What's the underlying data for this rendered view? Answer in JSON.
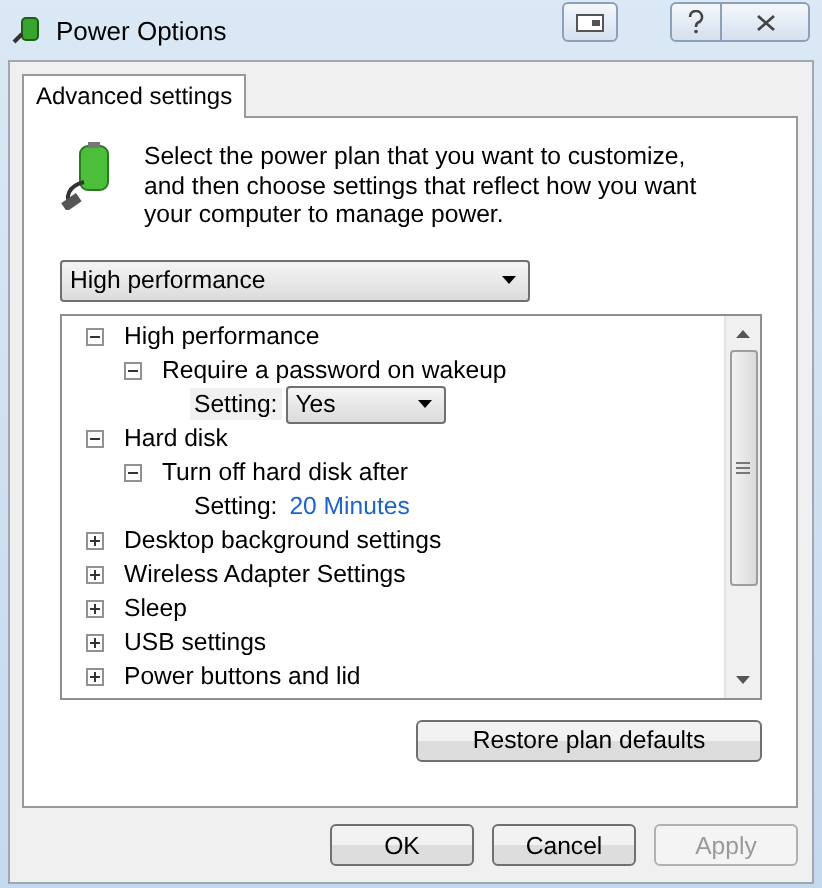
{
  "window": {
    "title": "Power Options"
  },
  "tabs": [
    {
      "label": "Advanced settings",
      "selected": true
    }
  ],
  "intro": "Select the power plan that you want to customize, and then choose settings that reflect how you want your computer to manage power.",
  "plan_dropdown": {
    "value": "High performance"
  },
  "tree": {
    "items": [
      {
        "kind": "group",
        "label": "High performance",
        "expanded": true,
        "children": [
          {
            "kind": "group",
            "label": "Require a password on wakeup",
            "expanded": true,
            "children": [
              {
                "kind": "select-setting",
                "label": "Setting:",
                "value": "Yes"
              }
            ]
          }
        ]
      },
      {
        "kind": "group",
        "label": "Hard disk",
        "expanded": true,
        "children": [
          {
            "kind": "group",
            "label": "Turn off hard disk after",
            "expanded": true,
            "children": [
              {
                "kind": "link-setting",
                "label": "Setting:",
                "value": "20 Minutes"
              }
            ]
          }
        ]
      },
      {
        "kind": "group",
        "label": "Desktop background settings",
        "expanded": false
      },
      {
        "kind": "group",
        "label": "Wireless Adapter Settings",
        "expanded": false
      },
      {
        "kind": "group",
        "label": "Sleep",
        "expanded": false
      },
      {
        "kind": "group",
        "label": "USB settings",
        "expanded": false
      },
      {
        "kind": "group",
        "label": "Power buttons and lid",
        "expanded": false
      }
    ]
  },
  "restore_button": "Restore plan defaults",
  "buttons": [
    {
      "label": "OK",
      "disabled": false
    },
    {
      "label": "Cancel",
      "disabled": false
    },
    {
      "label": "Apply",
      "disabled": true
    }
  ]
}
